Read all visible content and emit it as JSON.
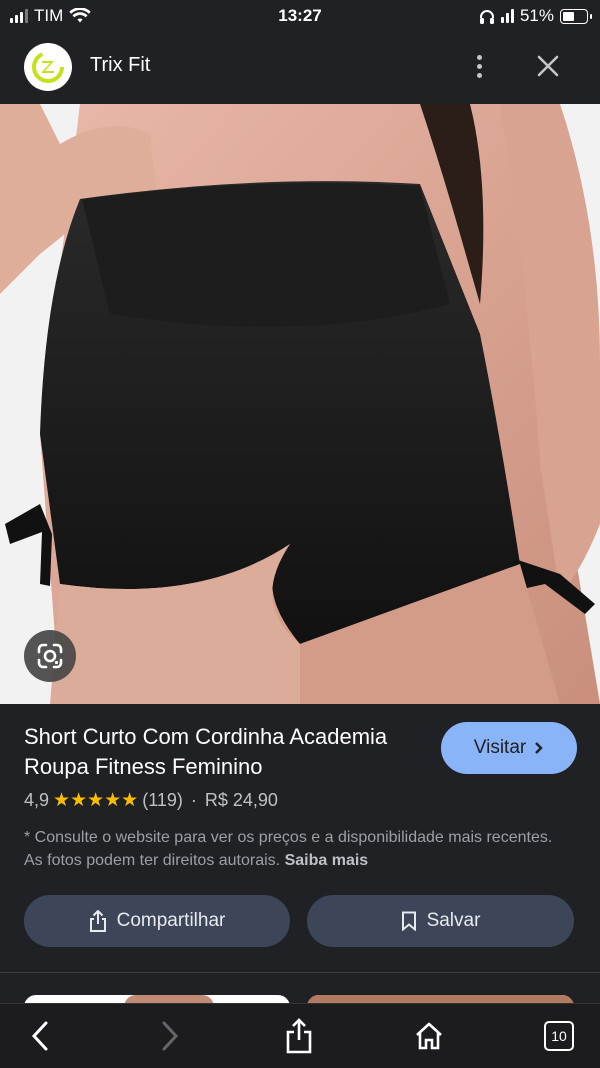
{
  "status_bar": {
    "carrier": "TIM",
    "time": "13:27",
    "battery": "51%"
  },
  "header": {
    "site_name": "Trix Fit"
  },
  "product": {
    "title": "Short Curto Com Cordinha Academia Roupa Fitness Feminino",
    "visit_label": "Visitar",
    "rating": "4,9",
    "stars": "★★★★★",
    "reviews": "(119)",
    "separator": "·",
    "price": "R$ 24,90",
    "disclaimer": "* Consulte o website para ver os preços e a disponibilidade mais recentes. As fotos podem ter direitos autorais.",
    "learn_more": "Saiba mais"
  },
  "actions": {
    "share_label": "Compartilhar",
    "save_label": "Salvar"
  },
  "toolbar": {
    "tabs_count": "10"
  },
  "colors": {
    "accent": "#8ab4f8",
    "star": "#fbbc04",
    "button_bg": "#3c4658",
    "background": "#202124",
    "logo_green": "#c6e11a"
  }
}
